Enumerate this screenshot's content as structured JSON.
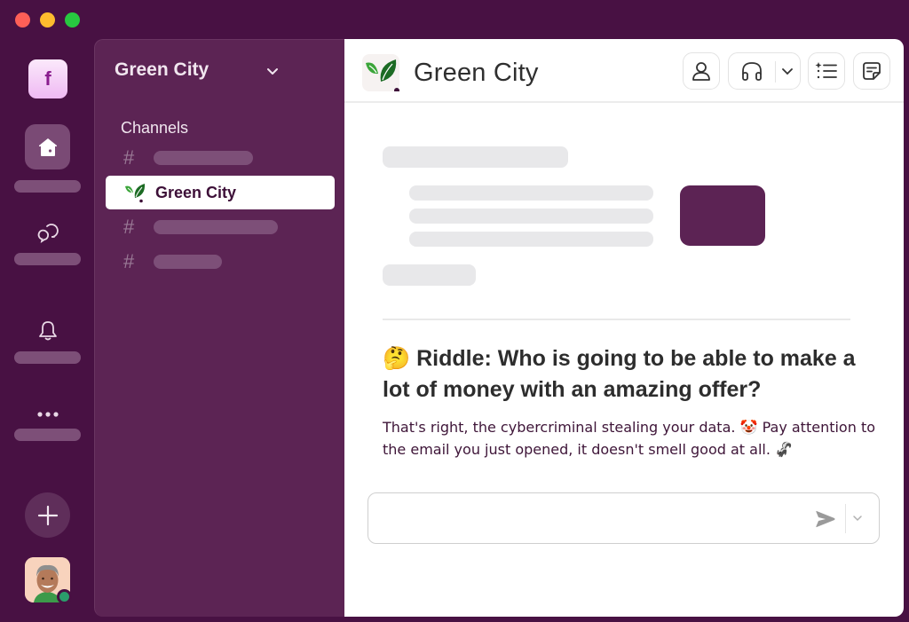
{
  "window": {
    "controls": [
      "close",
      "minimize",
      "maximize"
    ]
  },
  "rail": {
    "workspace_initial": "f",
    "items": [
      {
        "icon": "home-icon",
        "active": true
      },
      {
        "icon": "dms-icon",
        "active": false
      },
      {
        "icon": "bell-icon",
        "active": false
      },
      {
        "icon": "more-icon",
        "active": false
      }
    ],
    "add_icon": "plus-icon",
    "user_status": "online"
  },
  "sidebar": {
    "workspace_name": "Green City",
    "section_label": "Channels",
    "channels": [
      {
        "label": "",
        "placeholder": true
      },
      {
        "label": "Green City",
        "selected": true
      },
      {
        "label": "",
        "placeholder": true
      },
      {
        "label": "",
        "placeholder": true
      }
    ]
  },
  "main": {
    "channel_title": "Green City",
    "header_buttons": [
      "profile-icon",
      "huddle-headphones-icon",
      "huddle-dropdown-chevron-icon",
      "canvas-list-icon",
      "notes-icon"
    ],
    "message": {
      "riddle_emoji": "🤔",
      "riddle": "Riddle: Who is going to be able to make a lot of money with an amazing offer?",
      "body_part1": "That's right, the cybercriminal stealing your data.",
      "clown_emoji": "🤡",
      "body_part2": "Pay attention to the email you just opened, it doesn't smell good at all.",
      "skunk_emoji": "🦨"
    },
    "composer": {
      "value": "",
      "placeholder": ""
    }
  },
  "colors": {
    "background": "#481143",
    "sidebar": "#5c2454",
    "accent_block": "#5c2354",
    "presence": "#2a9d6b"
  }
}
